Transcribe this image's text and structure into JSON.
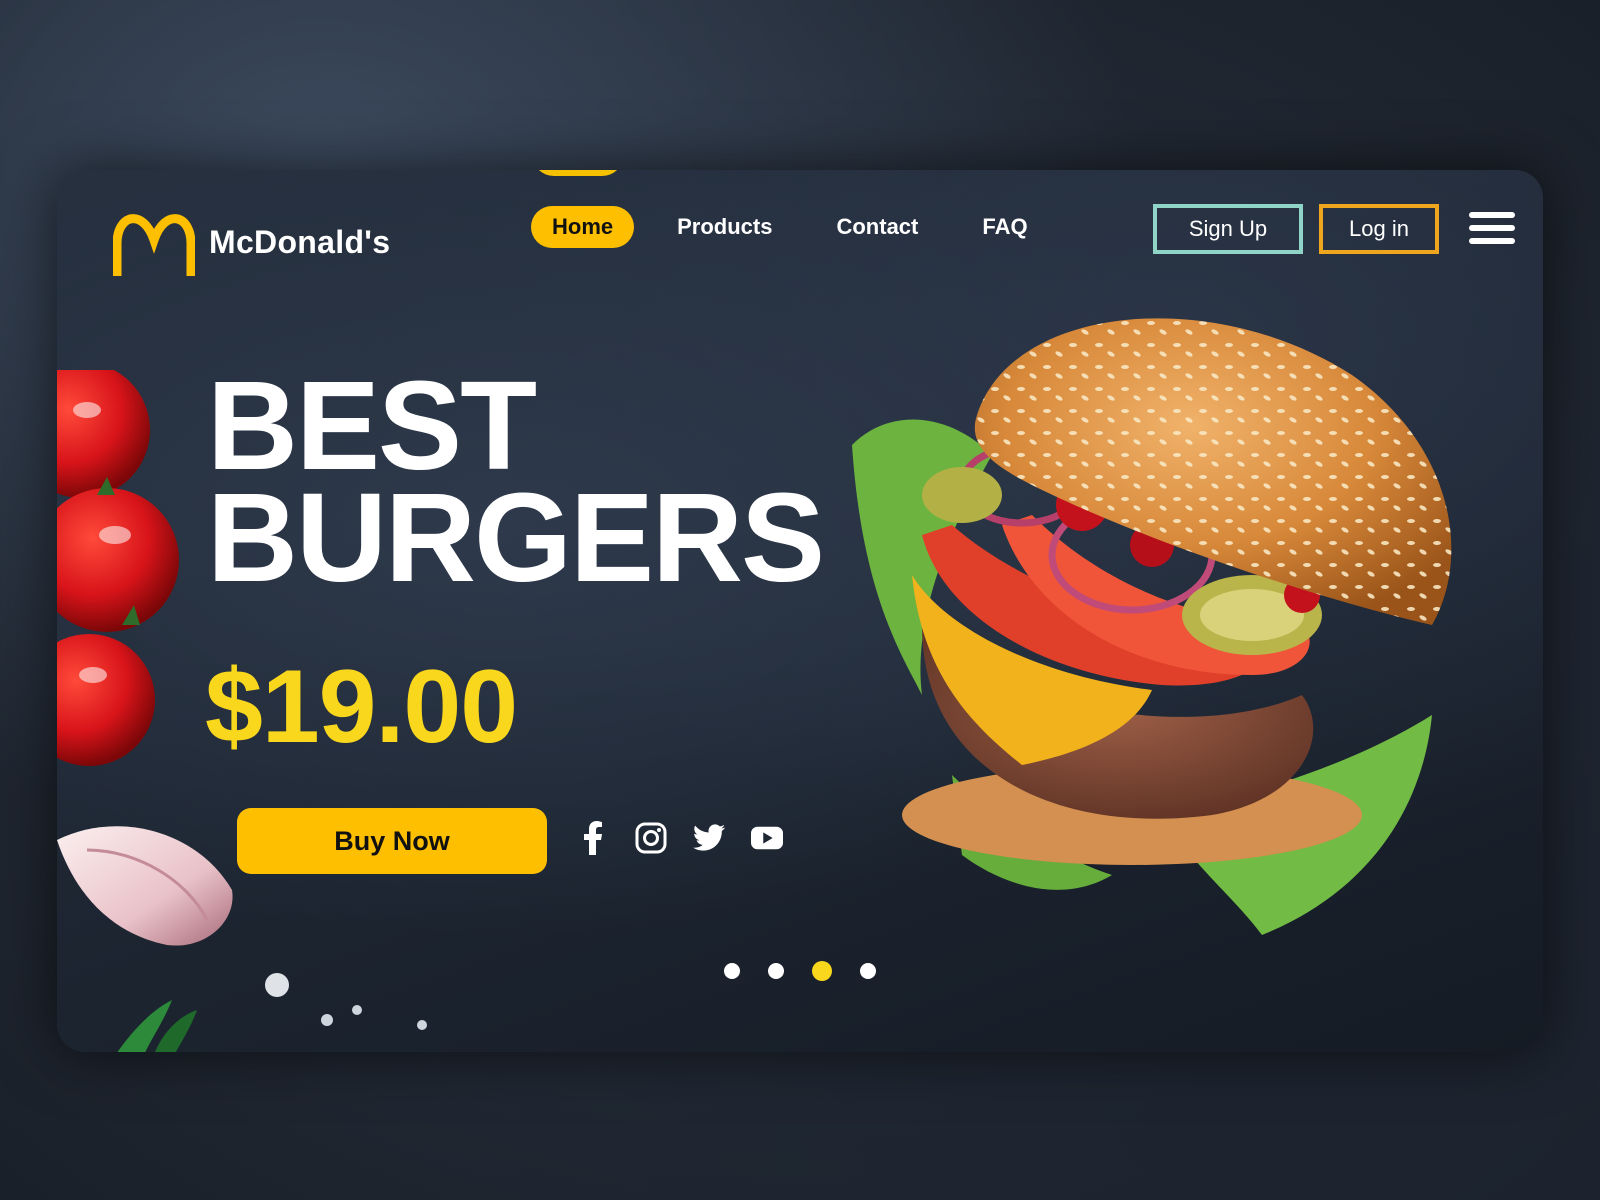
{
  "brand": {
    "name": "McDonald's",
    "accent": "#fdbf00",
    "price_color": "#f9d71c"
  },
  "nav": {
    "items": [
      {
        "label": "Home",
        "active": true
      },
      {
        "label": "Products",
        "active": false
      },
      {
        "label": "Contact",
        "active": false
      },
      {
        "label": "FAQ",
        "active": false
      }
    ]
  },
  "auth": {
    "signup_label": "Sign Up",
    "login_label": "Log in"
  },
  "hero": {
    "headline_line1": "BEST",
    "headline_line2": "BURGERS",
    "price": "$19.00",
    "cta_label": "Buy Now"
  },
  "social": [
    "facebook-icon",
    "instagram-icon",
    "twitter-icon",
    "youtube-icon"
  ],
  "carousel": {
    "dots": 4,
    "active_index": 2
  }
}
